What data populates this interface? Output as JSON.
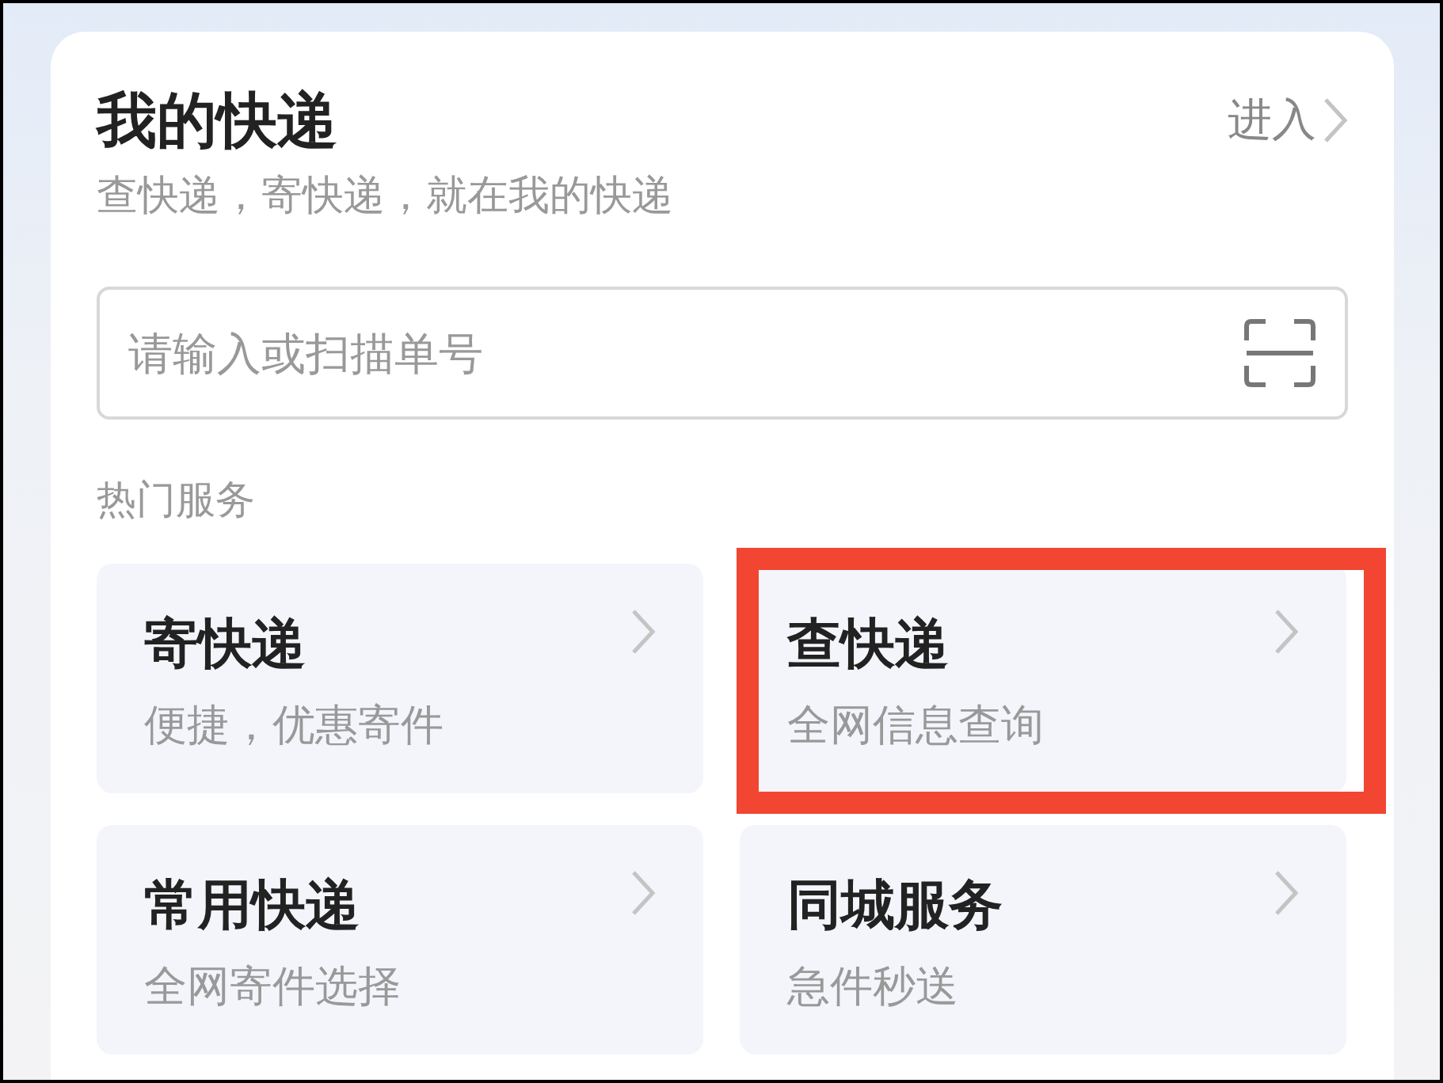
{
  "card": {
    "title": "我的快递",
    "enter_link": "进入",
    "subtitle": "查快递，寄快递，就在我的快递"
  },
  "search": {
    "placeholder": "请输入或扫描单号"
  },
  "services": {
    "heading": "热门服务",
    "items": [
      {
        "title": "寄快递",
        "subtitle": "便捷，优惠寄件",
        "highlighted": false
      },
      {
        "title": "查快递",
        "subtitle": "全网信息查询",
        "highlighted": true
      },
      {
        "title": "常用快递",
        "subtitle": "全网寄件选择",
        "highlighted": false
      },
      {
        "title": "同城服务",
        "subtitle": "急件秒送",
        "highlighted": false
      }
    ]
  }
}
